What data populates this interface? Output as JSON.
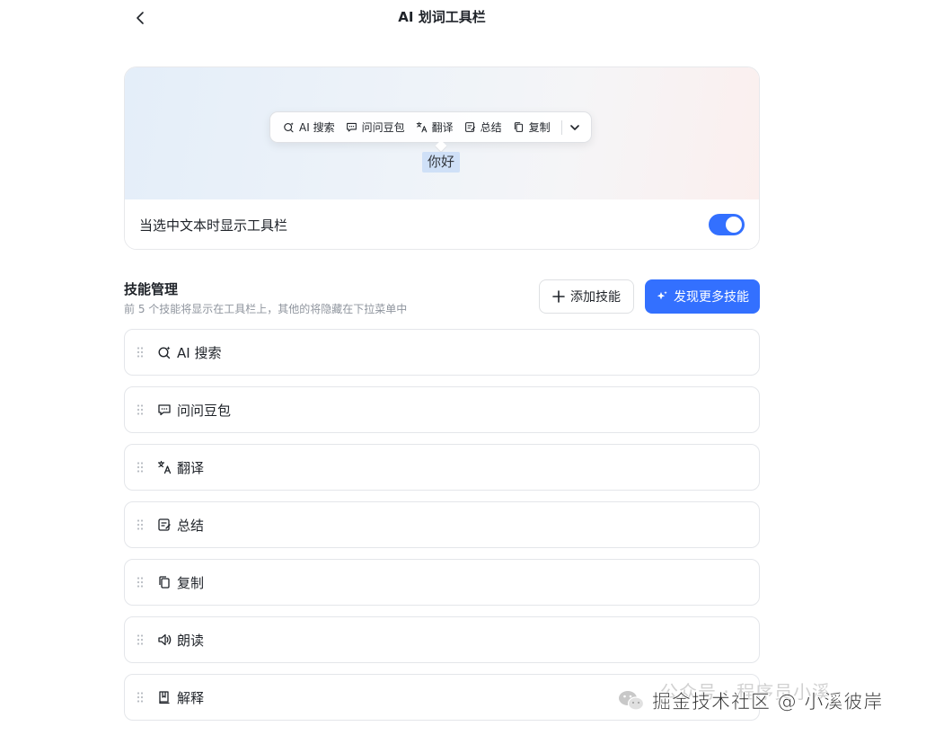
{
  "header": {
    "title": "AI 划词工具栏"
  },
  "preview": {
    "toolbar_items": [
      {
        "icon": "ai-search-icon",
        "label": "AI 搜索"
      },
      {
        "icon": "chat-icon",
        "label": "问问豆包"
      },
      {
        "icon": "translate-icon",
        "label": "翻译"
      },
      {
        "icon": "summary-icon",
        "label": "总结"
      },
      {
        "icon": "copy-icon",
        "label": "复制"
      }
    ],
    "selected_text": "你好",
    "setting_label": "当选中文本时显示工具栏",
    "toggle_on": true
  },
  "skills": {
    "title": "技能管理",
    "subtitle": "前 5 个技能将显示在工具栏上，其他的将隐藏在下拉菜单中",
    "add_button": "添加技能",
    "discover_button": "发现更多技能",
    "items": [
      {
        "icon": "ai-search-icon",
        "label": "AI 搜索"
      },
      {
        "icon": "chat-icon",
        "label": "问问豆包"
      },
      {
        "icon": "translate-icon",
        "label": "翻译"
      },
      {
        "icon": "summary-icon",
        "label": "总结"
      },
      {
        "icon": "copy-icon",
        "label": "复制"
      },
      {
        "icon": "speaker-icon",
        "label": "朗读"
      },
      {
        "icon": "book-icon",
        "label": "解释"
      }
    ]
  },
  "watermark": {
    "text": "掘金技术社区 @ 小溪彼岸",
    "sub_text": "公众号 · 程序员小溪"
  },
  "colors": {
    "accent": "#3370ff",
    "border": "#e4e6ea"
  }
}
